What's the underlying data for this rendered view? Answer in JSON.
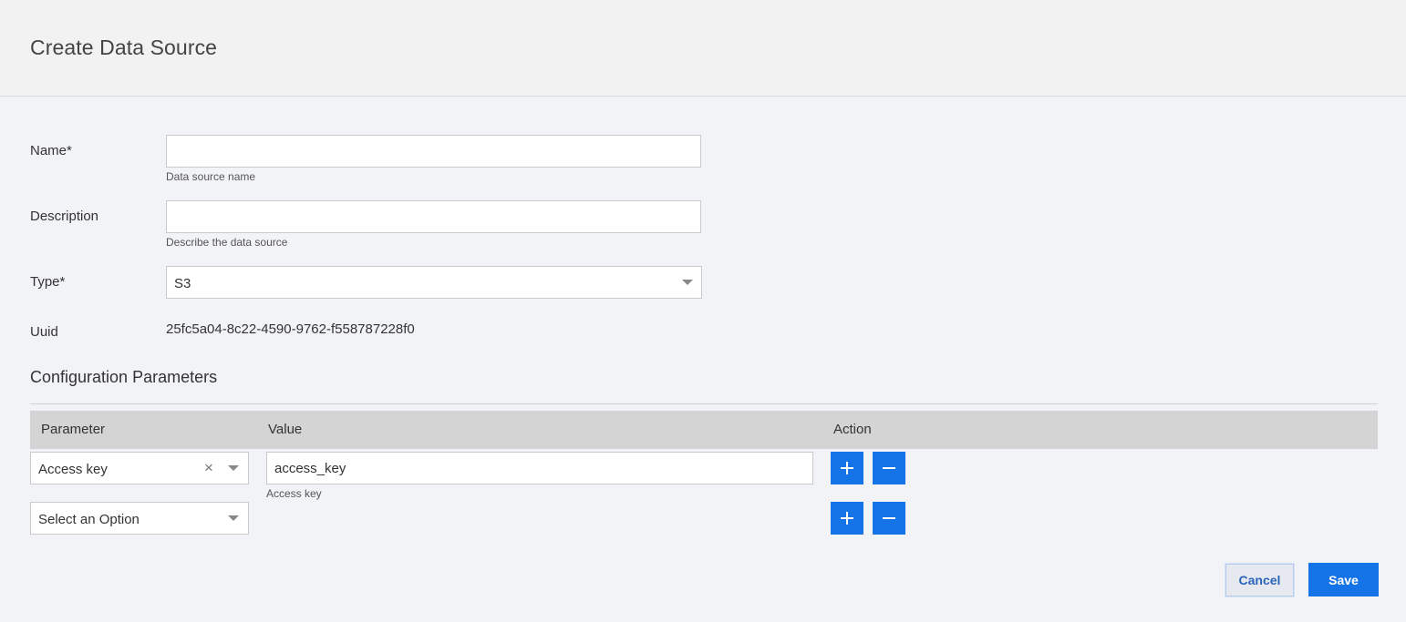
{
  "header": {
    "title": "Create Data Source"
  },
  "form": {
    "name": {
      "label": "Name*",
      "value": "",
      "hint": "Data source name"
    },
    "description": {
      "label": "Description",
      "value": "",
      "hint": "Describe the data source"
    },
    "type": {
      "label": "Type*",
      "value": "S3"
    },
    "uuid": {
      "label": "Uuid",
      "value": "25fc5a04-8c22-4590-9762-f558787228f0"
    }
  },
  "config": {
    "title": "Configuration Parameters",
    "columns": {
      "parameter": "Parameter",
      "value": "Value",
      "action": "Action"
    },
    "rows": [
      {
        "parameter": "Access key",
        "value": "access_key",
        "hint": "Access key"
      },
      {
        "parameter": "Select an Option"
      }
    ]
  },
  "footer": {
    "cancel_label": "Cancel",
    "save_label": "Save"
  },
  "colors": {
    "accent": "#1473e6",
    "header_bg": "#f2f2f2",
    "table_head_bg": "#d4d4d4"
  },
  "icons": {
    "add": "plus-icon",
    "remove": "minus-icon",
    "clear": "close-icon",
    "dropdown": "chevron-down-icon"
  }
}
